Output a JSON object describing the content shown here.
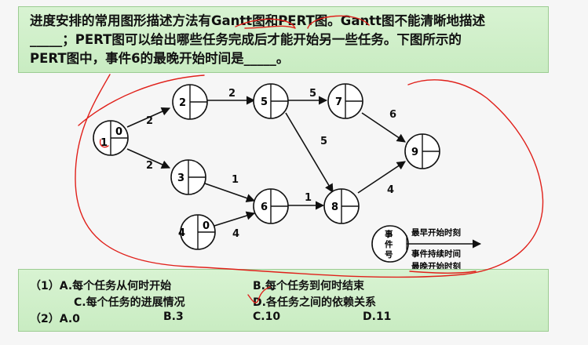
{
  "question": {
    "line1": "进度安排的常用图形描述方法有Gantt图和PERT图。Gantt图不能清晰地描述",
    "line2": "_____；PERT图可以给出哪些任务完成后才能开始另一些任务。下图所示的",
    "line3": "PERT图中，事件6的最晚开始时间是_____。"
  },
  "diagram": {
    "nodes": [
      {
        "id": "1",
        "value": "0"
      },
      {
        "id": "2",
        "value": ""
      },
      {
        "id": "3",
        "value": ""
      },
      {
        "id": "4",
        "value": "0"
      },
      {
        "id": "5",
        "value": ""
      },
      {
        "id": "6",
        "value": ""
      },
      {
        "id": "7",
        "value": ""
      },
      {
        "id": "8",
        "value": ""
      },
      {
        "id": "9",
        "value": ""
      }
    ],
    "edges": [
      {
        "from": "1",
        "to": "2",
        "weight": "2"
      },
      {
        "from": "1",
        "to": "3",
        "weight": "2"
      },
      {
        "from": "2",
        "to": "5",
        "weight": "2"
      },
      {
        "from": "3",
        "to": "6",
        "weight": "1"
      },
      {
        "from": "4",
        "to": "6",
        "weight": "4"
      },
      {
        "from": "5",
        "to": "7",
        "weight": "5"
      },
      {
        "from": "5",
        "to": "8",
        "weight": "5"
      },
      {
        "from": "6",
        "to": "8",
        "weight": "1"
      },
      {
        "from": "7",
        "to": "9",
        "weight": "6"
      },
      {
        "from": "8",
        "to": "9",
        "weight": "4"
      }
    ],
    "legend": {
      "event_no_1": "事",
      "event_no_2": "件",
      "event_no_3": "号",
      "earliest_start": "最早开始时刻",
      "duration": "事件持续时间",
      "latest_start": "最晚开始时刻"
    }
  },
  "options": {
    "q1_a": "（1）A.每个任务从何时开始",
    "q1_b": "B.每个任务到何时结束",
    "q1_c": "C.每个任务的进展情况",
    "q1_d": "D.各任务之间的依赖关系",
    "q2_label": "（2）A.0",
    "q2_b": "B.3",
    "q2_c": "C.10",
    "q2_d": "D.11"
  },
  "colors": {
    "box_bg": "#cdeec6",
    "ink": "#111111",
    "annotation": "#e0201a"
  }
}
